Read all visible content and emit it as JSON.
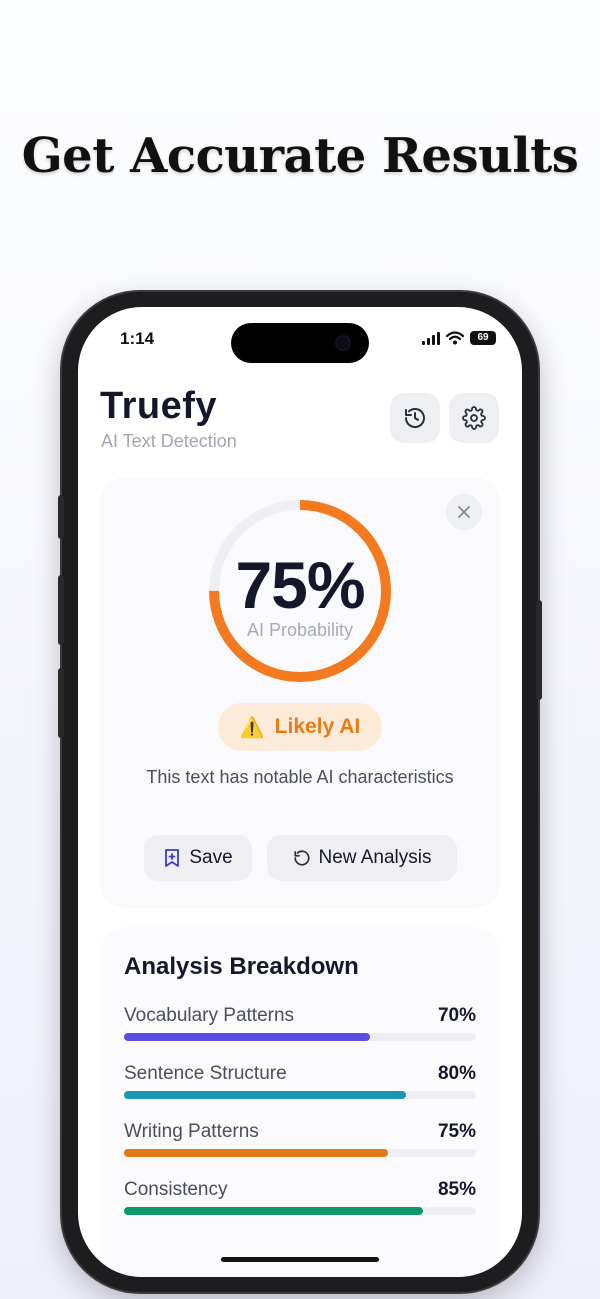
{
  "headline": "Get Accurate Results",
  "status_bar": {
    "time": "1:14",
    "battery": "69"
  },
  "app": {
    "title": "Truefy",
    "subtitle": "AI Text Detection"
  },
  "header_icons": [
    "history-icon",
    "gear-icon"
  ],
  "result": {
    "probability": 75,
    "probability_text": "75%",
    "probability_label": "AI Probability",
    "verdict_icon": "⚠️",
    "verdict": "Likely AI",
    "description": "This text has notable AI characteristics",
    "save_label": "Save",
    "new_analysis_label": "New Analysis"
  },
  "breakdown": {
    "title": "Analysis Breakdown",
    "metrics": [
      {
        "label": "Vocabulary Patterns",
        "value_text": "70%",
        "value": 70,
        "color": "#5b4ee0"
      },
      {
        "label": "Sentence Structure",
        "value_text": "80%",
        "value": 80,
        "color": "#1a97b7"
      },
      {
        "label": "Writing Patterns",
        "value_text": "75%",
        "value": 75,
        "color": "#dd7a13"
      },
      {
        "label": "Consistency",
        "value_text": "85%",
        "value": 85,
        "color": "#10996b"
      }
    ]
  },
  "colors": {
    "accent": "#f47a1f",
    "gauge_track": "#efeff3",
    "verdict_bg": "#fdebd9"
  }
}
